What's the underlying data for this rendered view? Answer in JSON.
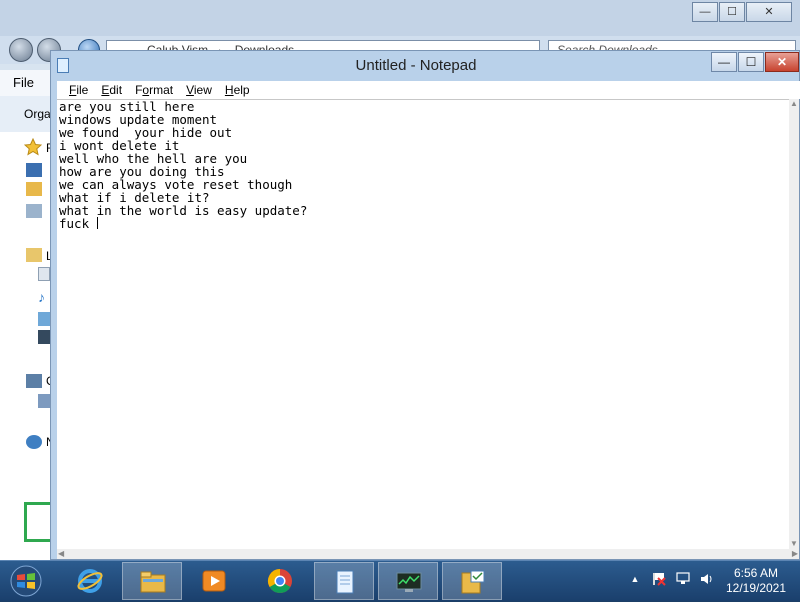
{
  "explorer": {
    "title_buttons": {
      "minimize": "—",
      "maximize": "☐",
      "close": "✕"
    },
    "breadcrumb": [
      "Calub Vism",
      "Downloads"
    ],
    "breadcrumb_sep": "►",
    "search_placeholder": "Search Downloads",
    "menu_partial": "File",
    "toolbar_partial": "Orga",
    "nav_letters": [
      "F",
      "L",
      "C",
      "N"
    ]
  },
  "notepad": {
    "title": "Untitled - Notepad",
    "buttons": {
      "minimize": "—",
      "maximize": "☐",
      "close": "✕"
    },
    "menu": [
      {
        "label": "File",
        "key": "F"
      },
      {
        "label": "Edit",
        "key": "E"
      },
      {
        "label": "Format",
        "key": "o"
      },
      {
        "label": "View",
        "key": "V"
      },
      {
        "label": "Help",
        "key": "H"
      }
    ],
    "lines": [
      "are you still here",
      "windows update moment",
      "we found  your hide out",
      "i wont delete it",
      "well who the hell are you",
      "how are you doing this",
      "we can always vote reset though",
      "what if i delete it?",
      "what in the world is easy update?",
      "fuck "
    ]
  },
  "taskbar": {
    "items": [
      {
        "name": "internet-explorer",
        "icon": "ie-icon"
      },
      {
        "name": "file-explorer",
        "icon": "folder-icon",
        "active": true
      },
      {
        "name": "media-player",
        "icon": "media-player-icon"
      },
      {
        "name": "chrome",
        "icon": "chrome-icon"
      },
      {
        "name": "notepad",
        "icon": "notepad-icon",
        "active": true
      },
      {
        "name": "task-manager",
        "icon": "task-manager-icon",
        "active": true
      },
      {
        "name": "folder-tasks",
        "icon": "folder-check-icon",
        "active": true
      }
    ],
    "tray": {
      "overflow_arrow": "▲",
      "time": "6:56 AM",
      "date": "12/19/2021"
    }
  }
}
